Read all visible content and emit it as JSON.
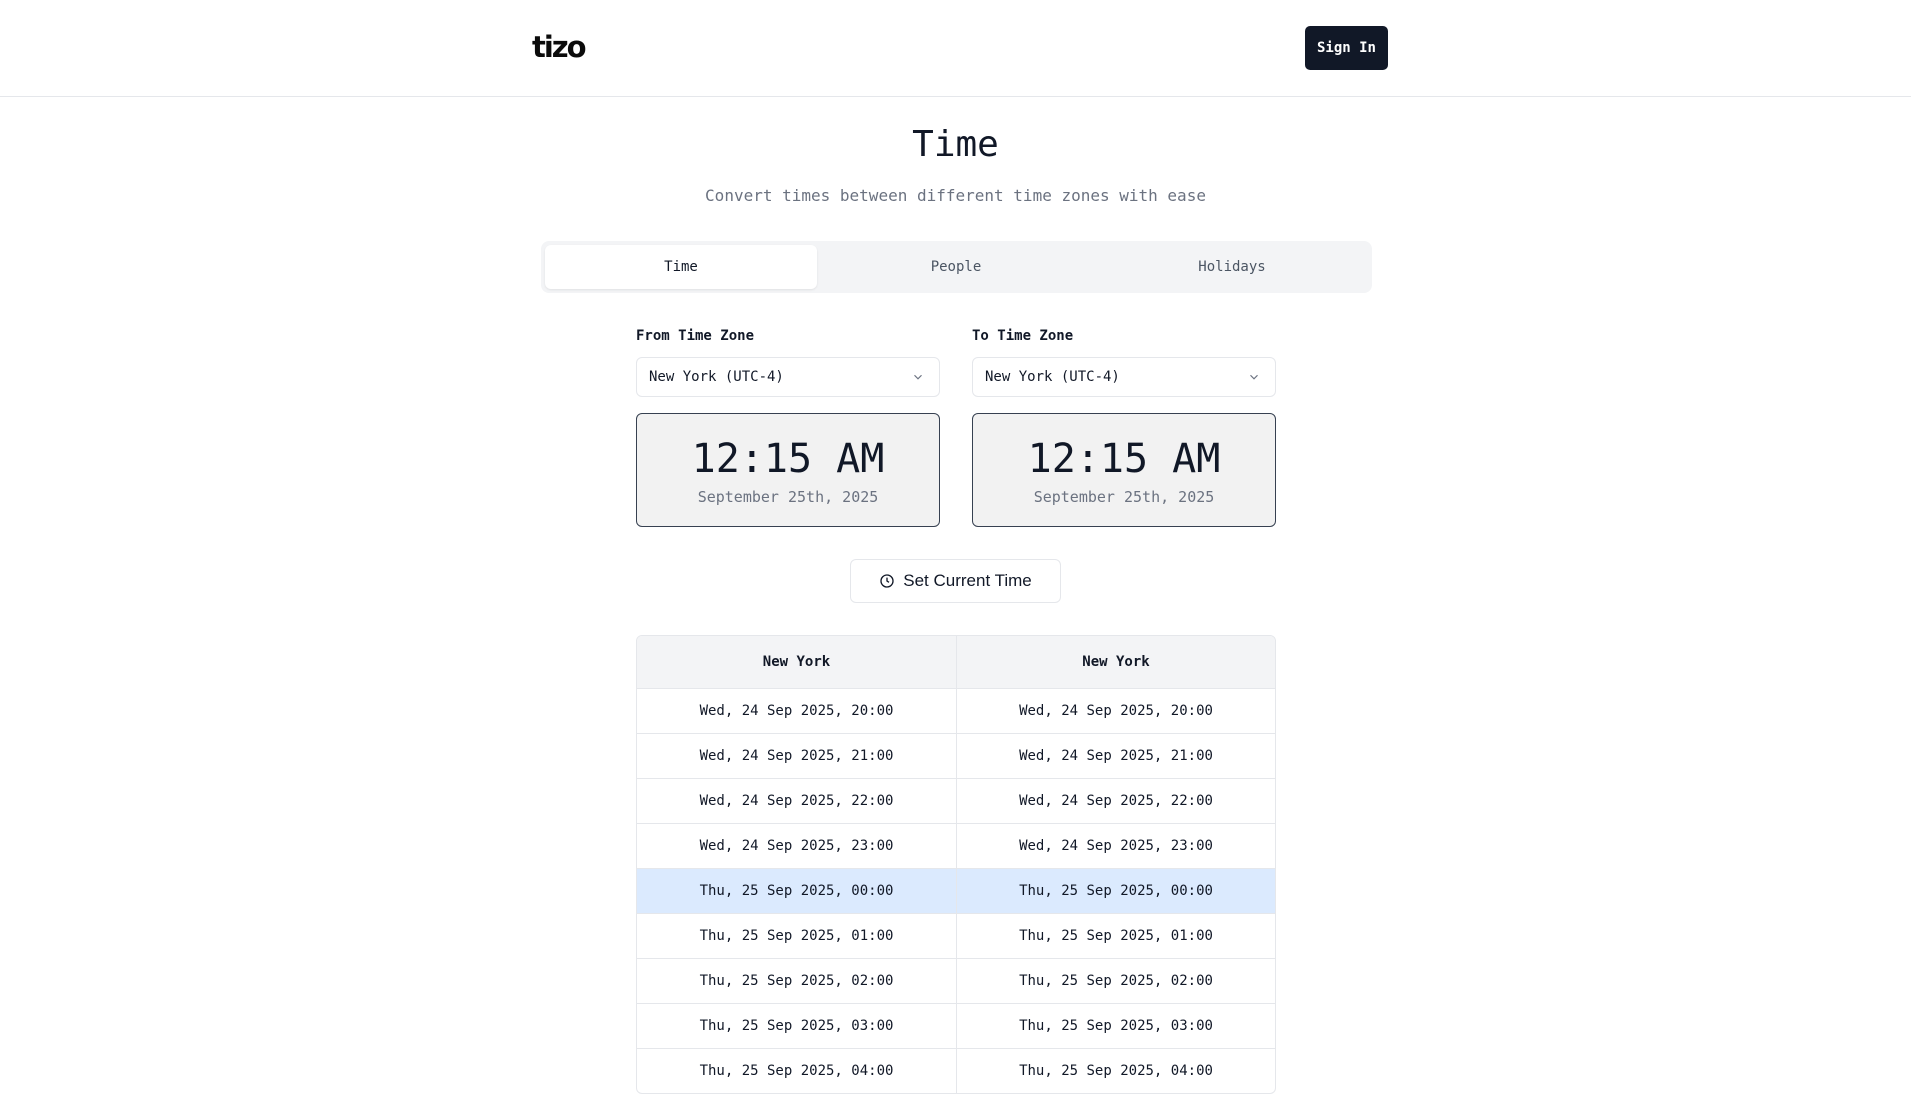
{
  "header": {
    "logo": "tizo",
    "signin_label": "Sign In"
  },
  "page": {
    "title": "Time",
    "subtitle": "Convert times between different time zones with ease"
  },
  "tabs": [
    {
      "label": "Time",
      "active": true
    },
    {
      "label": "People",
      "active": false
    },
    {
      "label": "Holidays",
      "active": false
    }
  ],
  "from": {
    "label": "From Time Zone",
    "selected": "New York (UTC-4)",
    "time": "12:15 AM",
    "date": "September 25th, 2025"
  },
  "to": {
    "label": "To Time Zone",
    "selected": "New York (UTC-4)",
    "time": "12:15 AM",
    "date": "September 25th, 2025"
  },
  "set_current_label": "Set Current Time",
  "table": {
    "headers": [
      "New York",
      "New York"
    ],
    "rows": [
      [
        "Wed, 24 Sep 2025, 20:00",
        "Wed, 24 Sep 2025, 20:00"
      ],
      [
        "Wed, 24 Sep 2025, 21:00",
        "Wed, 24 Sep 2025, 21:00"
      ],
      [
        "Wed, 24 Sep 2025, 22:00",
        "Wed, 24 Sep 2025, 22:00"
      ],
      [
        "Wed, 24 Sep 2025, 23:00",
        "Wed, 24 Sep 2025, 23:00"
      ],
      [
        "Thu, 25 Sep 2025, 00:00",
        "Thu, 25 Sep 2025, 00:00"
      ],
      [
        "Thu, 25 Sep 2025, 01:00",
        "Thu, 25 Sep 2025, 01:00"
      ],
      [
        "Thu, 25 Sep 2025, 02:00",
        "Thu, 25 Sep 2025, 02:00"
      ],
      [
        "Thu, 25 Sep 2025, 03:00",
        "Thu, 25 Sep 2025, 03:00"
      ],
      [
        "Thu, 25 Sep 2025, 04:00",
        "Thu, 25 Sep 2025, 04:00"
      ]
    ],
    "highlighted_row": 4
  },
  "colors": {
    "primary": "#111827",
    "highlight": "#dbeafe",
    "muted": "#6b7280"
  }
}
